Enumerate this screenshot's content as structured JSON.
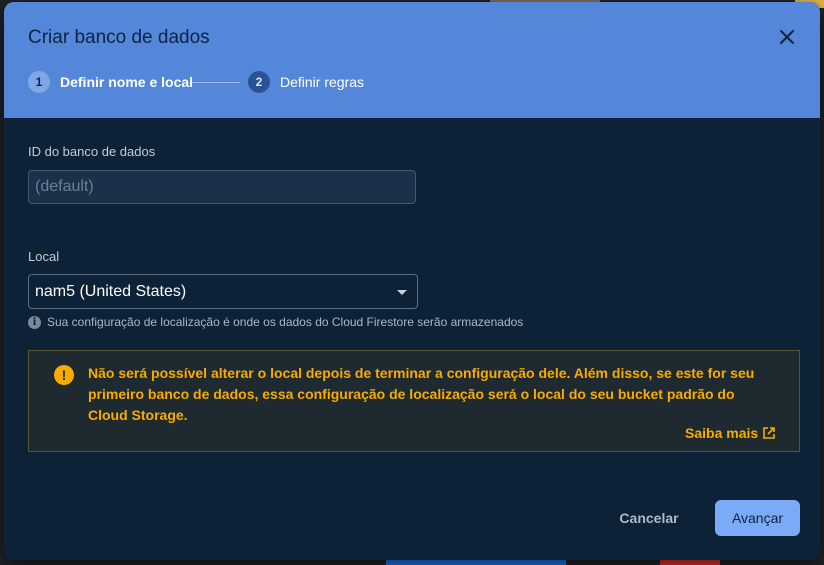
{
  "dialog": {
    "title": "Criar banco de dados",
    "close_icon": "close-icon"
  },
  "steps": [
    {
      "number": "1",
      "label": "Definir nome e local",
      "active": true
    },
    {
      "number": "2",
      "label": "Definir regras",
      "active": false
    }
  ],
  "database_id": {
    "label": "ID do banco de dados",
    "value": "",
    "placeholder": "(default)"
  },
  "location": {
    "label": "Local",
    "selected": "nam5 (United States)",
    "hint_icon": "info-icon",
    "hint": "Sua configuração de localização é onde os dados do Cloud Firestore serão armazenados"
  },
  "warning": {
    "icon": "warning-icon",
    "text": "Não será possível alterar o local depois de terminar a configuração dele. Além disso, se este for seu primeiro banco de dados, essa configuração de localização será o local do seu bucket padrão do Cloud Storage.",
    "link_label": "Saiba mais",
    "link_icon": "open-in-new-icon"
  },
  "footer": {
    "cancel_label": "Cancelar",
    "next_label": "Avançar"
  },
  "colors": {
    "header": "#5487d9",
    "body": "#0d2137",
    "warning": "#f9ab00",
    "primary_button": "#7baaf7"
  }
}
